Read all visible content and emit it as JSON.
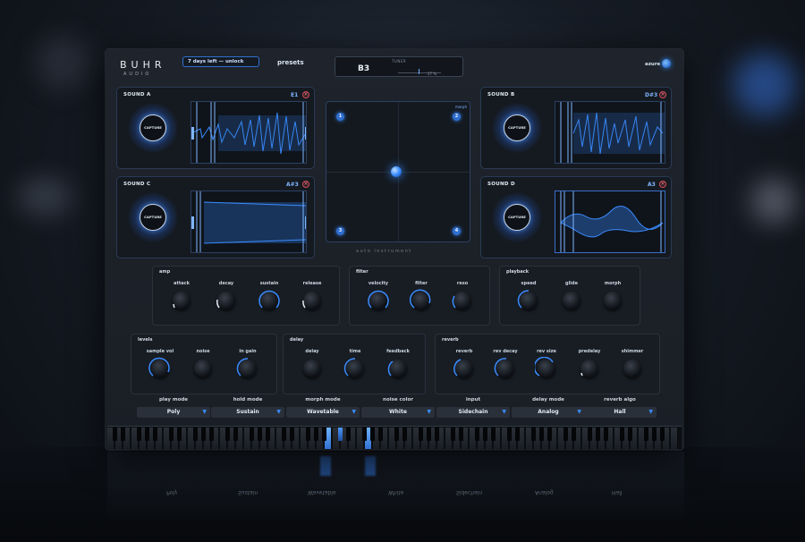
{
  "header": {
    "brand": "BUHR",
    "brand_sub": "AUDIO",
    "trial_label": "7 days left — unlock",
    "presets_label": "presets",
    "tuner": {
      "label": "TUNER",
      "note": "B3",
      "cents": "27 %"
    },
    "theme_label": "azure",
    "accent_color": "#2f6fd0"
  },
  "sounds": [
    {
      "title": "SOUND A",
      "note": "E1",
      "capture": "CAPTURE"
    },
    {
      "title": "SOUND B",
      "note": "D#3",
      "capture": "CAPTURE"
    },
    {
      "title": "SOUND C",
      "note": "A#3",
      "capture": "CAPTURE"
    },
    {
      "title": "SOUND D",
      "note": "A3",
      "capture": "CAPTURE"
    }
  ],
  "morph_pad": {
    "label": "morph",
    "corners": [
      "1",
      "2",
      "3",
      "4"
    ],
    "footer": "auto instrument"
  },
  "panels": {
    "amp": {
      "title": "amp",
      "knobs": [
        "attack",
        "decay",
        "sustain",
        "release"
      ]
    },
    "filter": {
      "title": "filter",
      "knobs": [
        "velocity",
        "filter",
        "reso"
      ]
    },
    "playback": {
      "title": "playback",
      "knobs": [
        "speed",
        "glide",
        "morph"
      ]
    },
    "levels": {
      "title": "levels",
      "knobs": [
        "sample vol",
        "noise",
        "in gain"
      ]
    },
    "delay": {
      "title": "delay",
      "knobs": [
        "delay",
        "time",
        "feedback"
      ]
    },
    "reverb": {
      "title": "reverb",
      "knobs": [
        "reverb",
        "rev decay",
        "rev size",
        "predelay",
        "shimmer"
      ]
    }
  },
  "dropdowns": [
    {
      "label": "play mode",
      "value": "Poly"
    },
    {
      "label": "hold mode",
      "value": "Sustain"
    },
    {
      "label": "morph mode",
      "value": "Wavetable"
    },
    {
      "label": "noise color",
      "value": "White"
    },
    {
      "label": "input",
      "value": "Sidechain"
    },
    {
      "label": "delay mode",
      "value": "Analog"
    },
    {
      "label": "reverb algo",
      "value": "Hall"
    }
  ],
  "icons": {
    "close": "close-icon",
    "dropdown_arrow": "chevron-down-icon"
  }
}
